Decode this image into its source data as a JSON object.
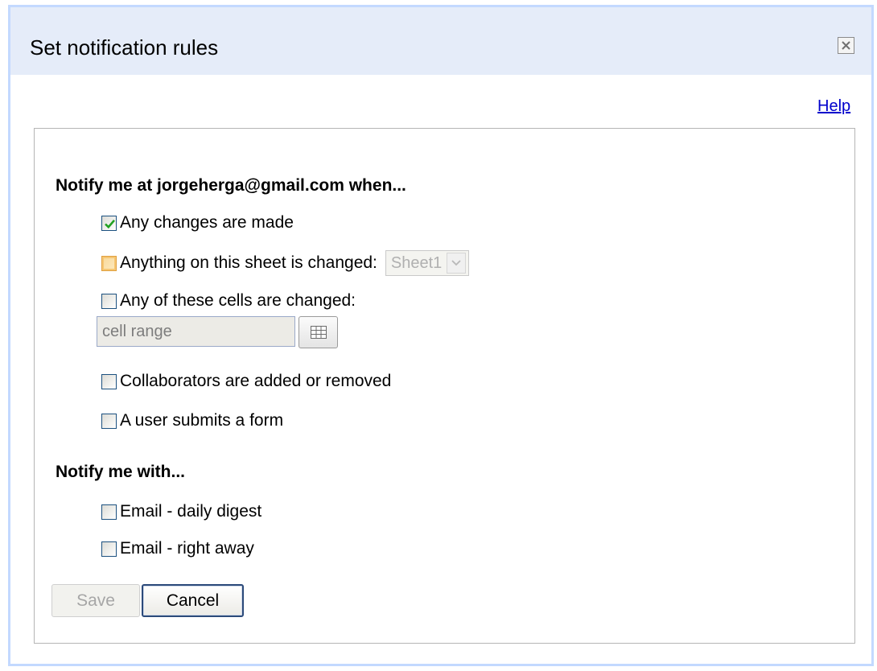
{
  "dialog": {
    "title": "Set notification rules",
    "close_icon": "close-icon",
    "help_label": "Help",
    "colors": {
      "titlebar": "#e5ecf9",
      "border": "#c3d9ff",
      "link": "#0000cc",
      "checkmark": "#21a121"
    }
  },
  "notify_when": {
    "heading": "Notify me at jorgeherga@gmail.com when...",
    "options": [
      {
        "label": "Any changes are made",
        "checked": true
      },
      {
        "label": "Anything on this sheet is changed:",
        "checked": false,
        "highlighted": true
      },
      {
        "label": "Any of these cells are changed:",
        "checked": false
      },
      {
        "label": "Collaborators are added or removed",
        "checked": false
      },
      {
        "label": "A user submits a form",
        "checked": false
      }
    ],
    "sheet_select": {
      "value": "Sheet1",
      "disabled": true
    },
    "cell_range": {
      "placeholder": "cell range",
      "value": ""
    },
    "cell_range_button_icon": "grid-icon"
  },
  "notify_with": {
    "heading": "Notify me with...",
    "options": [
      {
        "label": "Email - daily digest",
        "checked": false
      },
      {
        "label": "Email - right away",
        "checked": false
      }
    ]
  },
  "buttons": {
    "save_label": "Save",
    "save_disabled": true,
    "cancel_label": "Cancel"
  }
}
